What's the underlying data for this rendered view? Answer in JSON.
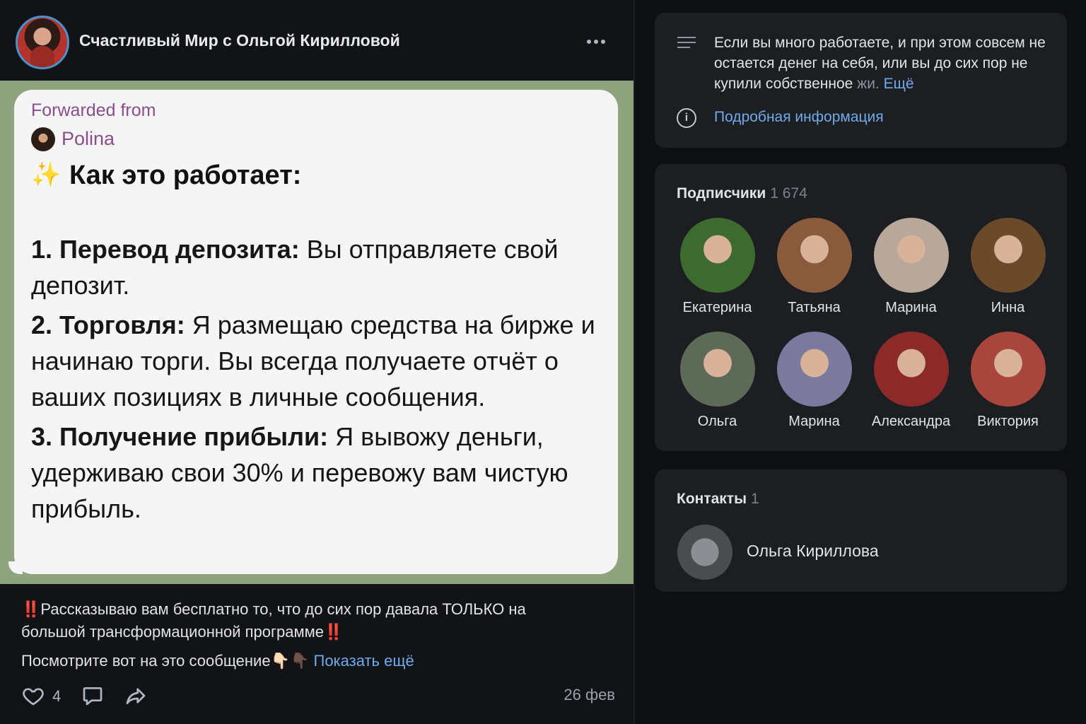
{
  "post": {
    "channel_name": "Счастливый Мир с Ольгой Кирилловой",
    "forwarded_label": "Forwarded from",
    "forwarded_author": "Polina",
    "message_title": "Как это работает:",
    "steps": [
      {
        "heading": "1. Перевод депозита:",
        "text": " Вы отправляете свой депозит."
      },
      {
        "heading": "2. Торговля:",
        "text": " Я размещаю средства на бирже и начинаю торги. Вы всегда получаете отчёт о ваших позициях в личные сообщения."
      },
      {
        "heading": "3. Получение прибыли:",
        "text": " Я вывожу деньги, удерживаю свои 30% и перевожу вам чистую прибыль."
      }
    ],
    "caption_prefix": "‼️",
    "caption_text": "Рассказываю вам бесплатно то, что до сих пор давала ТОЛЬКО на большой трансформационной программе",
    "caption_suffix": "‼️",
    "caption_line2": "Посмотрите вот на это сообщение👇🏻👇🏿",
    "show_more": "Показать ещё",
    "likes": "4",
    "date": "26 фев"
  },
  "about": {
    "text_main": "Если вы много работаете, и при этом совсем не остается денег на себя, или вы до сих пор не купили собственное ",
    "text_faded": "жи.",
    "more": "Ещё",
    "info_link": "Подробная информация"
  },
  "subscribers": {
    "title": "Подписчики",
    "count": "1 674",
    "items": [
      {
        "name": "Екатерина",
        "color": "#3d6b2f"
      },
      {
        "name": "Татьяна",
        "color": "#8a5a3c"
      },
      {
        "name": "Марина",
        "color": "#b7a89a"
      },
      {
        "name": "Инна",
        "color": "#6b4a2a"
      },
      {
        "name": "Ольга",
        "color": "#5e6a58"
      },
      {
        "name": "Марина",
        "color": "#7b7a9e"
      },
      {
        "name": "Александра",
        "color": "#8c2a2a"
      },
      {
        "name": "Виктория",
        "color": "#a8453c"
      }
    ]
  },
  "contacts": {
    "title": "Контакты",
    "count": "1",
    "items": [
      {
        "name": "Ольга Кириллова"
      }
    ]
  }
}
